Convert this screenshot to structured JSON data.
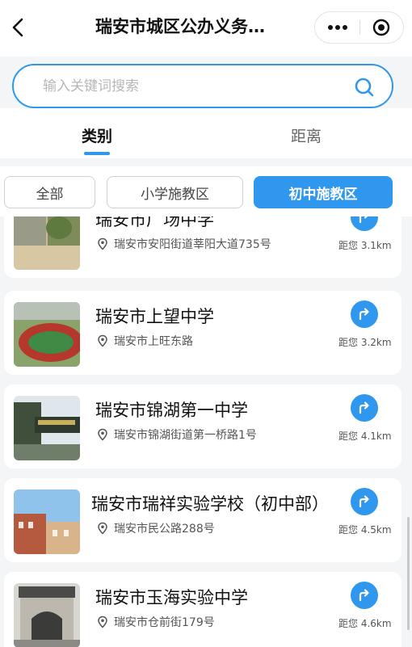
{
  "header": {
    "title": "瑞安市城区公办义务…"
  },
  "search": {
    "placeholder": "输入关键词搜索"
  },
  "tabs": [
    {
      "label": "类别",
      "active": true
    },
    {
      "label": "距离",
      "active": false
    }
  ],
  "filters": [
    {
      "label": "全部",
      "active": false
    },
    {
      "label": "小学施教区",
      "active": false
    },
    {
      "label": "初中施教区",
      "active": true
    }
  ],
  "schools": [
    {
      "name": "瑞安市广场中学",
      "address": "瑞安市安阳街道莘阳大道735号",
      "distance": "距您 3.1km",
      "thumb": "courtyard-photo"
    },
    {
      "name": "瑞安市上望中学",
      "address": "瑞安市上旺东路",
      "distance": "距您 3.2km",
      "thumb": "running-track-photo"
    },
    {
      "name": "瑞安市锦湖第一中学",
      "address": "瑞安市锦湖街道第一桥路1号",
      "distance": "距您 4.1km",
      "thumb": "school-gate-photo"
    },
    {
      "name": "瑞安市瑞祥实验学校（初中部）",
      "address": "瑞安市民公路288号",
      "distance": "距您 4.5km",
      "thumb": "campus-building-photo"
    },
    {
      "name": "瑞安市玉海实验中学",
      "address": "瑞安市仓前街179号",
      "distance": "距您 4.6km",
      "thumb": "arch-gate-photo"
    }
  ],
  "colors": {
    "accent": "#2f98ee",
    "background": "#f4f5f7"
  }
}
